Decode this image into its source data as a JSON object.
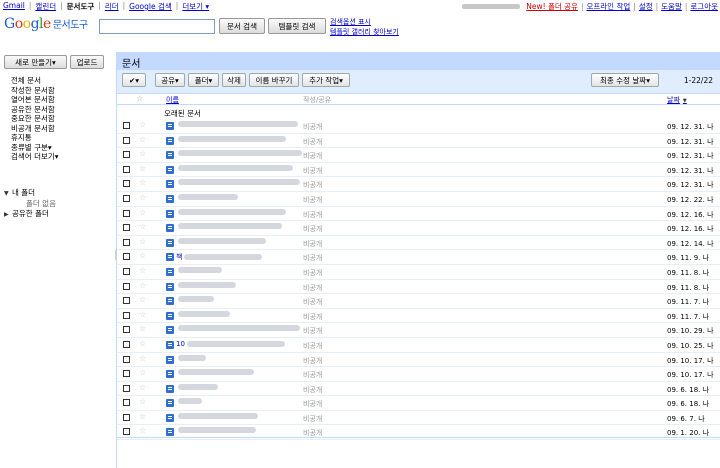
{
  "topnav": {
    "items": [
      "Gmail",
      "캘린더",
      "문서도구",
      "리더",
      "Google 검색",
      "더보기 ▾"
    ],
    "current_index": 2
  },
  "topright": {
    "new_link": "New! 폴더 공유",
    "links": [
      "오프라인 작업",
      "설정",
      "도움말",
      "로그아웃"
    ]
  },
  "header": {
    "logo_text": "Google",
    "product_name": "문서도구",
    "search_docs_btn": "문서 검색",
    "search_templates_btn": "템플릿 검색",
    "show_search_options": "검색옵션 표시",
    "browse_template_gallery": "템플릿 갤러리 찾아보기"
  },
  "sidebar": {
    "new_btn": "새로 만들기▾",
    "upload_btn": "업로드",
    "nav": [
      "전체 문서",
      "작성한 문서함",
      "열어본 문서함",
      "공유한 문서함",
      "중요한 문서함",
      "비공개 문서함",
      "휴지통",
      "종류별 구분▾",
      "검색어 더보기▾"
    ],
    "my_folders": "내 폴더",
    "no_folders": "폴더 없음",
    "shared_folders": "공유한 폴더"
  },
  "main": {
    "title": "문서",
    "toolbar": {
      "check": "✔▾",
      "share": "공유▾",
      "folder": "폴더▾",
      "delete": "삭제",
      "rename": "이름 바꾸기",
      "more_actions": "추가 작업▾",
      "sort": "최종 수정 날짜▾",
      "count": "1-22/22"
    },
    "columns": {
      "name": "이름",
      "owner": "작성/공유",
      "date": "날짜",
      "date_sort_arrow": "▼"
    },
    "group_label": "오래된 문서",
    "rows": [
      {
        "prefix": "",
        "blur": 120,
        "owner": "비공개",
        "date": "09. 12. 31.",
        "suffix": "나"
      },
      {
        "prefix": "",
        "blur": 108,
        "owner": "비공개",
        "date": "09. 12. 31.",
        "suffix": "나"
      },
      {
        "prefix": "",
        "blur": 124,
        "owner": "비공개",
        "date": "09. 12. 31.",
        "suffix": "나"
      },
      {
        "prefix": "",
        "blur": 115,
        "owner": "비공개",
        "date": "09. 12. 31.",
        "suffix": "나"
      },
      {
        "prefix": "",
        "blur": 122,
        "owner": "비공개",
        "date": "09. 12. 31.",
        "suffix": "나"
      },
      {
        "prefix": "",
        "blur": 60,
        "owner": "비공개",
        "date": "09. 12. 22.",
        "suffix": "나"
      },
      {
        "prefix": "",
        "blur": 108,
        "owner": "비공개",
        "date": "09. 12. 16.",
        "suffix": "나"
      },
      {
        "prefix": "",
        "blur": 104,
        "owner": "비공개",
        "date": "09. 12. 16.",
        "suffix": "나"
      },
      {
        "prefix": "",
        "blur": 88,
        "owner": "비공개",
        "date": "09. 12. 14.",
        "suffix": "나"
      },
      {
        "prefix": "책",
        "blur": 78,
        "owner": "비공개",
        "date": "09. 11. 9.",
        "suffix": "나"
      },
      {
        "prefix": "",
        "blur": 44,
        "owner": "비공개",
        "date": "09. 11. 8.",
        "suffix": "나"
      },
      {
        "prefix": "",
        "blur": 58,
        "owner": "비공개",
        "date": "09. 11. 8.",
        "suffix": "나"
      },
      {
        "prefix": "",
        "blur": 36,
        "owner": "비공개",
        "date": "09. 11. 7.",
        "suffix": "나"
      },
      {
        "prefix": "",
        "blur": 52,
        "owner": "비공개",
        "date": "09. 11. 7.",
        "suffix": "나"
      },
      {
        "prefix": "",
        "blur": 122,
        "owner": "비공개",
        "date": "09. 10. 29.",
        "suffix": "나"
      },
      {
        "prefix": "10",
        "blur": 98,
        "owner": "비공개",
        "date": "09. 10. 25.",
        "suffix": "나"
      },
      {
        "prefix": "",
        "blur": 28,
        "owner": "비공개",
        "date": "09. 10. 17.",
        "suffix": "나"
      },
      {
        "prefix": "",
        "blur": 76,
        "owner": "비공개",
        "date": "09. 10. 17.",
        "suffix": "나"
      },
      {
        "prefix": "",
        "blur": 40,
        "owner": "비공개",
        "date": "09. 6. 18.",
        "suffix": "나"
      },
      {
        "prefix": "",
        "blur": 24,
        "owner": "비공개",
        "date": "09. 6. 18.",
        "suffix": "나"
      },
      {
        "prefix": "",
        "blur": 80,
        "owner": "비공개",
        "date": "09. 6. 7.",
        "suffix": "나"
      },
      {
        "prefix": "",
        "blur": 78,
        "owner": "비공개",
        "date": "09. 1. 20.",
        "suffix": "나"
      }
    ]
  }
}
